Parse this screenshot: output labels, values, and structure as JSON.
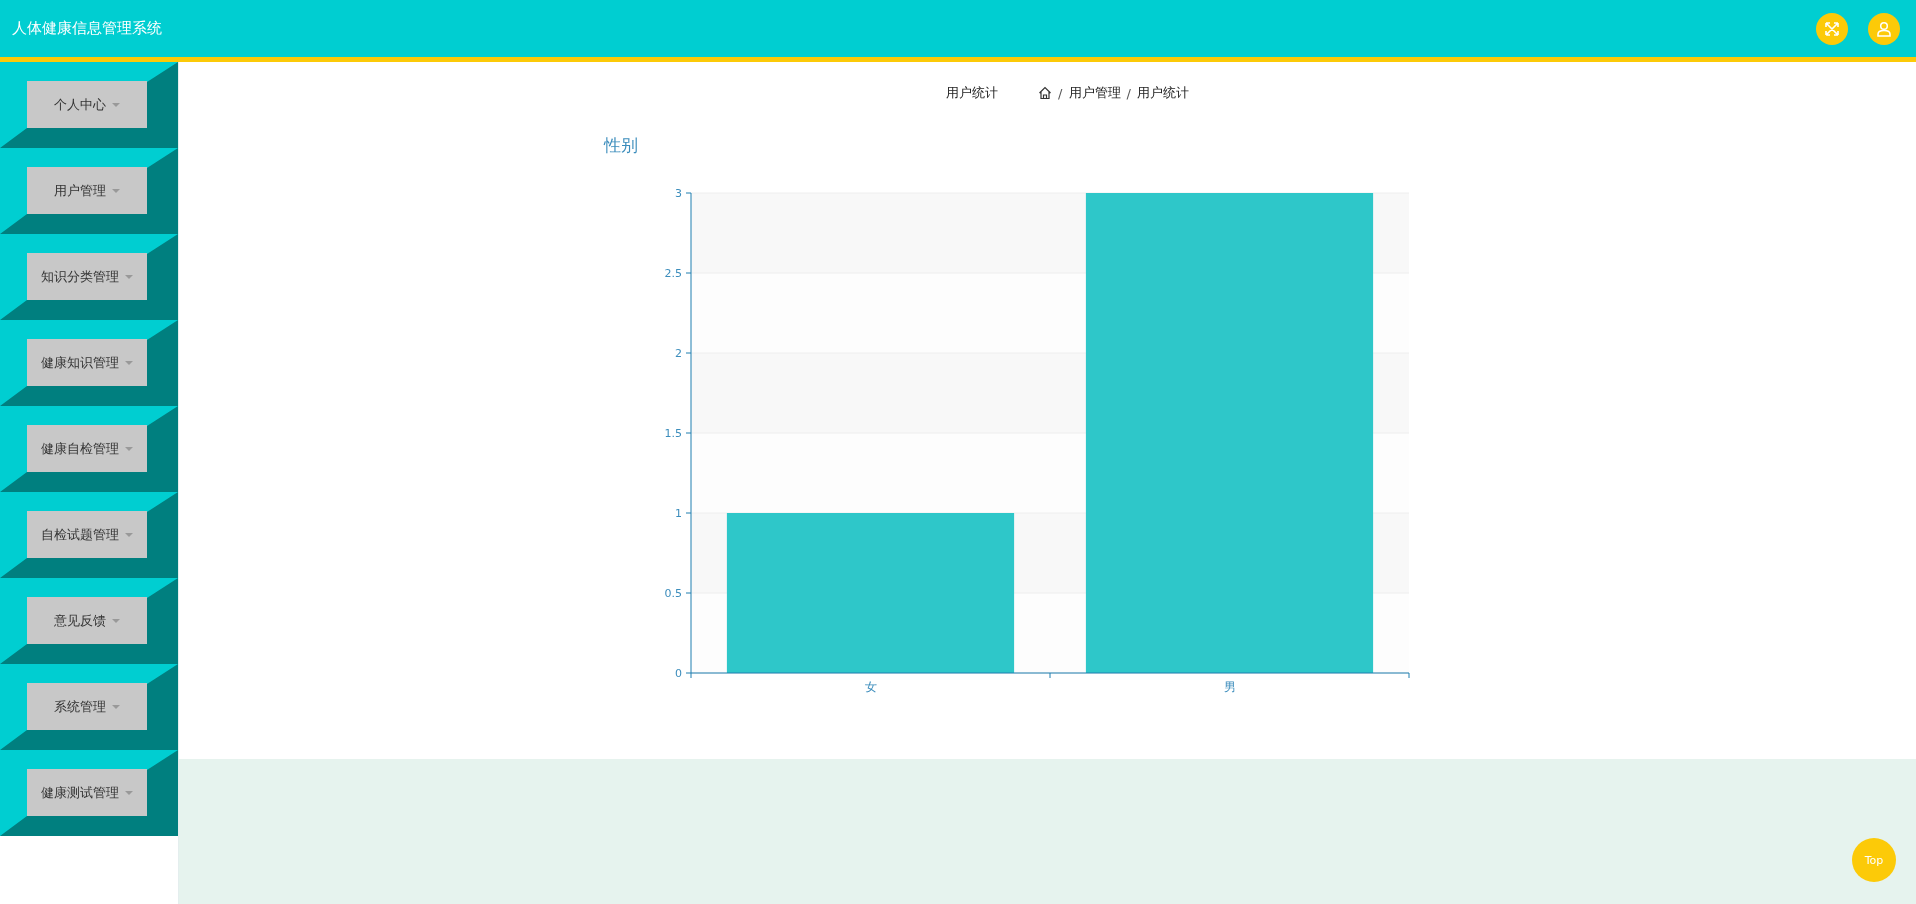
{
  "header": {
    "title": "人体健康信息管理系统"
  },
  "sidebar": {
    "items": [
      {
        "label": "个人中心"
      },
      {
        "label": "用户管理"
      },
      {
        "label": "知识分类管理"
      },
      {
        "label": "健康知识管理"
      },
      {
        "label": "健康自检管理"
      },
      {
        "label": "自检试题管理"
      },
      {
        "label": "意见反馈"
      },
      {
        "label": "系统管理"
      },
      {
        "label": "健康测试管理"
      }
    ]
  },
  "page_title": "用户统计",
  "breadcrumb": {
    "separator": "/",
    "items": [
      "用户管理",
      "用户统计"
    ]
  },
  "chart": {
    "chart_data": {
      "type": "bar",
      "title": "性别",
      "categories": [
        "女",
        "男"
      ],
      "series": [
        {
          "color": "#2ec7c9",
          "values": [
            1,
            3
          ]
        }
      ],
      "grid": true,
      "ylim": [
        0,
        3
      ],
      "yticks": [
        0,
        0.5,
        1,
        1.5,
        2,
        2.5,
        3
      ]
    }
  },
  "top_button": "Top"
}
